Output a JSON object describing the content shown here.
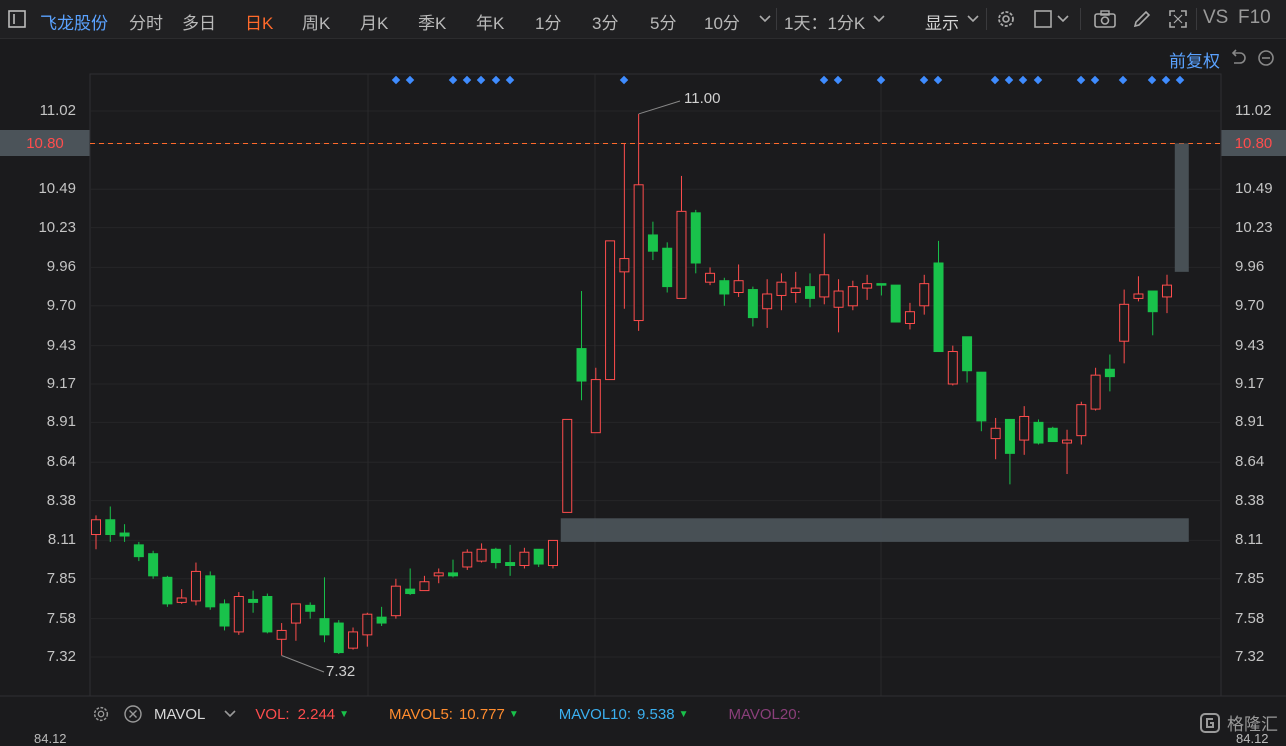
{
  "toolbar": {
    "stock_name": "飞龙股份",
    "periods": [
      "分时",
      "多日",
      "日K",
      "周K",
      "月K",
      "季K",
      "年K",
      "1分",
      "3分",
      "5分",
      "10分"
    ],
    "selected_period": "日K",
    "range_label": "1天：1分K",
    "display_label": "显示",
    "vs_label": "VS",
    "f10_label": "F10"
  },
  "subheader": {
    "adjust_label": "前复权"
  },
  "price_axis": {
    "ticks": [
      "11.02",
      "10.80",
      "10.49",
      "10.23",
      "9.96",
      "9.70",
      "9.43",
      "9.17",
      "8.91",
      "8.64",
      "8.38",
      "8.11",
      "7.85",
      "7.58",
      "7.32"
    ],
    "highlight": "10.80",
    "bottom_partial": "84.12"
  },
  "annotations": {
    "high": "11.00",
    "low": "7.32"
  },
  "indicator": {
    "name": "MAVOL",
    "vol_label": "VOL:",
    "vol_value": "2.244",
    "mavol5_label": "MAVOL5:",
    "mavol5_value": "10.777",
    "mavol10_label": "MAVOL10:",
    "mavol10_value": "9.538",
    "mavol20_label": "MAVOL20:"
  },
  "watermark": "格隆汇",
  "colors": {
    "up": "#ff4d4d",
    "down": "#19c24b",
    "accent": "#ff6a2b",
    "link": "#5aa2ff",
    "dot": "#3f8cff"
  },
  "chart_data": {
    "type": "candlestick",
    "ylim": [
      7.18,
      11.21
    ],
    "y_ticks": [
      11.02,
      10.8,
      10.49,
      10.23,
      9.96,
      9.7,
      9.43,
      9.17,
      8.91,
      8.64,
      8.38,
      8.11,
      7.85,
      7.58,
      7.32
    ],
    "reference_line": 10.8,
    "candles": [
      {
        "o": 8.15,
        "c": 8.25,
        "h": 8.28,
        "l": 8.05
      },
      {
        "o": 8.25,
        "c": 8.15,
        "h": 8.34,
        "l": 8.1
      },
      {
        "o": 8.16,
        "c": 8.14,
        "h": 8.22,
        "l": 8.1
      },
      {
        "o": 8.08,
        "c": 8.0,
        "h": 8.1,
        "l": 7.97
      },
      {
        "o": 8.02,
        "c": 7.87,
        "h": 8.04,
        "l": 7.85
      },
      {
        "o": 7.86,
        "c": 7.68,
        "h": 7.87,
        "l": 7.66
      },
      {
        "o": 7.69,
        "c": 7.72,
        "h": 7.78,
        "l": 7.68
      },
      {
        "o": 7.7,
        "c": 7.9,
        "h": 7.96,
        "l": 7.67
      },
      {
        "o": 7.87,
        "c": 7.66,
        "h": 7.9,
        "l": 7.64
      },
      {
        "o": 7.68,
        "c": 7.53,
        "h": 7.71,
        "l": 7.5
      },
      {
        "o": 7.49,
        "c": 7.73,
        "h": 7.76,
        "l": 7.47
      },
      {
        "o": 7.71,
        "c": 7.69,
        "h": 7.77,
        "l": 7.62
      },
      {
        "o": 7.73,
        "c": 7.49,
        "h": 7.75,
        "l": 7.48
      },
      {
        "o": 7.44,
        "c": 7.5,
        "h": 7.55,
        "l": 7.33
      },
      {
        "o": 7.55,
        "c": 7.68,
        "h": 7.68,
        "l": 7.43
      },
      {
        "o": 7.67,
        "c": 7.63,
        "h": 7.69,
        "l": 7.58
      },
      {
        "o": 7.58,
        "c": 7.47,
        "h": 7.86,
        "l": 7.42
      },
      {
        "o": 7.55,
        "c": 7.35,
        "h": 7.57,
        "l": 7.34
      },
      {
        "o": 7.38,
        "c": 7.49,
        "h": 7.52,
        "l": 7.37
      },
      {
        "o": 7.47,
        "c": 7.61,
        "h": 7.62,
        "l": 7.39
      },
      {
        "o": 7.59,
        "c": 7.55,
        "h": 7.66,
        "l": 7.53
      },
      {
        "o": 7.6,
        "c": 7.8,
        "h": 7.85,
        "l": 7.58
      },
      {
        "o": 7.78,
        "c": 7.75,
        "h": 7.92,
        "l": 7.74
      },
      {
        "o": 7.77,
        "c": 7.83,
        "h": 7.87,
        "l": 7.77
      },
      {
        "o": 7.87,
        "c": 7.89,
        "h": 7.92,
        "l": 7.82
      },
      {
        "o": 7.89,
        "c": 7.87,
        "h": 7.98,
        "l": 7.86
      },
      {
        "o": 7.93,
        "c": 8.03,
        "h": 8.05,
        "l": 7.91
      },
      {
        "o": 7.97,
        "c": 8.05,
        "h": 8.09,
        "l": 7.96
      },
      {
        "o": 8.05,
        "c": 7.96,
        "h": 8.06,
        "l": 7.92
      },
      {
        "o": 7.96,
        "c": 7.94,
        "h": 8.08,
        "l": 7.87
      },
      {
        "o": 7.94,
        "c": 8.03,
        "h": 8.06,
        "l": 7.92
      },
      {
        "o": 8.05,
        "c": 7.95,
        "h": 8.05,
        "l": 7.93
      },
      {
        "o": 7.94,
        "c": 8.11,
        "h": 8.11,
        "l": 7.92
      },
      {
        "o": 8.3,
        "c": 8.93,
        "h": 8.93,
        "l": 8.3
      },
      {
        "o": 9.41,
        "c": 9.19,
        "h": 9.8,
        "l": 9.06
      },
      {
        "o": 8.84,
        "c": 9.2,
        "h": 9.28,
        "l": 8.84
      },
      {
        "o": 9.2,
        "c": 10.14,
        "h": 10.14,
        "l": 9.2
      },
      {
        "o": 9.93,
        "c": 10.02,
        "h": 10.8,
        "l": 9.68
      },
      {
        "o": 9.6,
        "c": 10.52,
        "h": 11.0,
        "l": 9.53
      },
      {
        "o": 10.18,
        "c": 10.07,
        "h": 10.27,
        "l": 10.01
      },
      {
        "o": 10.09,
        "c": 9.83,
        "h": 10.13,
        "l": 9.79
      },
      {
        "o": 9.75,
        "c": 10.34,
        "h": 10.58,
        "l": 9.75
      },
      {
        "o": 10.33,
        "c": 9.99,
        "h": 10.35,
        "l": 9.92
      },
      {
        "o": 9.86,
        "c": 9.92,
        "h": 9.96,
        "l": 9.84
      },
      {
        "o": 9.87,
        "c": 9.78,
        "h": 9.89,
        "l": 9.7
      },
      {
        "o": 9.79,
        "c": 9.87,
        "h": 9.98,
        "l": 9.76
      },
      {
        "o": 9.81,
        "c": 9.62,
        "h": 9.83,
        "l": 9.56
      },
      {
        "o": 9.68,
        "c": 9.78,
        "h": 9.88,
        "l": 9.55
      },
      {
        "o": 9.77,
        "c": 9.86,
        "h": 9.92,
        "l": 9.67
      },
      {
        "o": 9.79,
        "c": 9.82,
        "h": 9.93,
        "l": 9.72
      },
      {
        "o": 9.83,
        "c": 9.75,
        "h": 9.92,
        "l": 9.69
      },
      {
        "o": 9.76,
        "c": 9.91,
        "h": 10.19,
        "l": 9.71
      },
      {
        "o": 9.69,
        "c": 9.8,
        "h": 9.88,
        "l": 9.52
      },
      {
        "o": 9.7,
        "c": 9.83,
        "h": 9.87,
        "l": 9.67
      },
      {
        "o": 9.82,
        "c": 9.85,
        "h": 9.91,
        "l": 9.74
      },
      {
        "o": 9.85,
        "c": 9.84,
        "h": 9.85,
        "l": 9.77
      },
      {
        "o": 9.84,
        "c": 9.59,
        "h": 9.84,
        "l": 9.59
      },
      {
        "o": 9.58,
        "c": 9.66,
        "h": 9.72,
        "l": 9.54
      },
      {
        "o": 9.7,
        "c": 9.85,
        "h": 9.91,
        "l": 9.64
      },
      {
        "o": 9.99,
        "c": 9.39,
        "h": 10.14,
        "l": 9.39
      },
      {
        "o": 9.17,
        "c": 9.39,
        "h": 9.43,
        "l": 9.16
      },
      {
        "o": 9.49,
        "c": 9.26,
        "h": 9.49,
        "l": 9.18
      },
      {
        "o": 9.25,
        "c": 8.92,
        "h": 9.25,
        "l": 8.85
      },
      {
        "o": 8.8,
        "c": 8.87,
        "h": 8.94,
        "l": 8.66
      },
      {
        "o": 8.93,
        "c": 8.7,
        "h": 8.93,
        "l": 8.49
      },
      {
        "o": 8.79,
        "c": 8.95,
        "h": 9.02,
        "l": 8.69
      },
      {
        "o": 8.91,
        "c": 8.77,
        "h": 8.93,
        "l": 8.76
      },
      {
        "o": 8.87,
        "c": 8.78,
        "h": 8.88,
        "l": 8.78
      },
      {
        "o": 8.77,
        "c": 8.79,
        "h": 8.86,
        "l": 8.56
      },
      {
        "o": 8.82,
        "c": 9.03,
        "h": 9.05,
        "l": 8.76
      },
      {
        "o": 9.0,
        "c": 9.23,
        "h": 9.28,
        "l": 8.99
      },
      {
        "o": 9.27,
        "c": 9.22,
        "h": 9.37,
        "l": 9.12
      },
      {
        "o": 9.46,
        "c": 9.71,
        "h": 9.81,
        "l": 9.31
      },
      {
        "o": 9.75,
        "c": 9.78,
        "h": 9.9,
        "l": 9.73
      },
      {
        "o": 9.8,
        "c": 9.66,
        "h": 9.8,
        "l": 9.5
      },
      {
        "o": 9.76,
        "c": 9.84,
        "h": 9.91,
        "l": 9.65
      }
    ],
    "boxes": [
      {
        "y_top": 8.26,
        "y_bottom": 8.1,
        "x_from_index": 33,
        "x_to_index": 76
      },
      {
        "y_top": 10.8,
        "y_bottom": 9.93,
        "x_from_index": 76,
        "x_to_index": 76
      }
    ],
    "markers": [
      "dot-row"
    ]
  }
}
